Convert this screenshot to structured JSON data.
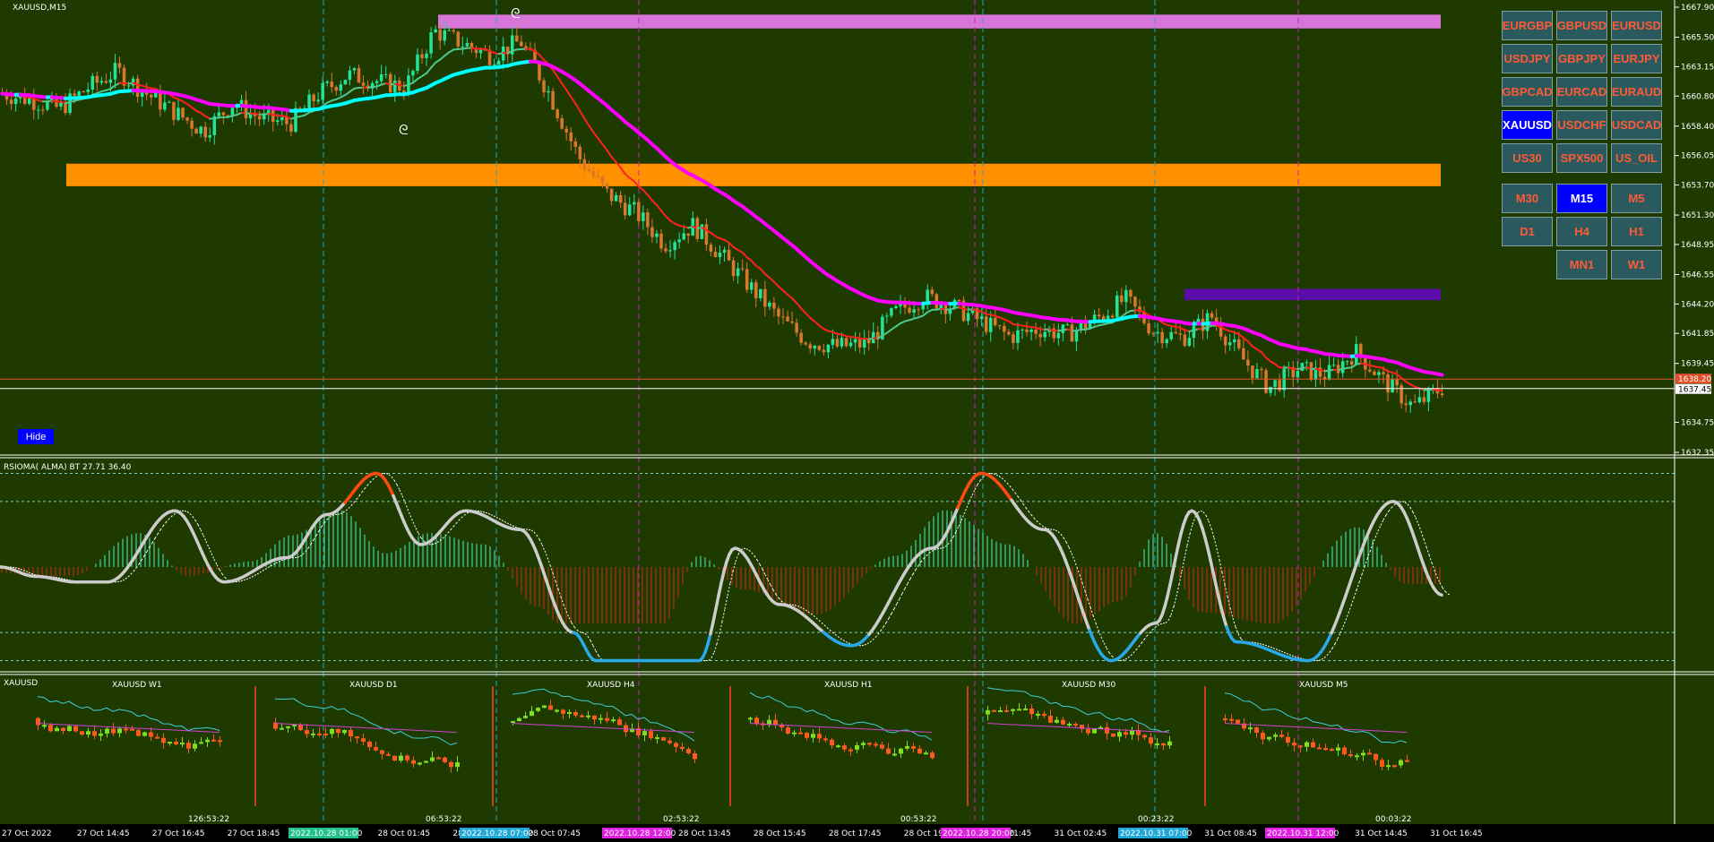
{
  "window": {
    "symbol_label": "XAUUSD,M15"
  },
  "colors": {
    "background": "#1e3a00",
    "bull": "#22e39a",
    "bear": "#d9772c",
    "ma_fast": "#ff2020",
    "ma_slow": "#ff00ff",
    "ma_fast_bull": "#4dc990",
    "ma_slow_bull": "#00ffff",
    "zone_top": "#d875d8",
    "zone_mid": "#ff9000",
    "zone_right": "#5a0ca8",
    "vline_cyan": "#20a8c0",
    "vline_magenta": "#c020c0",
    "rsi_line": "#cccccc",
    "rsi_hot": "#ff4a10",
    "rsi_cold": "#2aa8e8",
    "mini_bull": "#7ee01e",
    "mini_bear": "#ff5a1c",
    "active_button": "#0000ff"
  },
  "price_axis": {
    "ticks": [
      "1667.90",
      "1665.50",
      "1663.15",
      "1660.80",
      "1658.40",
      "1656.05",
      "1653.70",
      "1651.30",
      "1648.95",
      "1646.55",
      "1644.20",
      "1641.85",
      "1639.45",
      "1634.75",
      "1632.35"
    ],
    "price_tag_red": "1638.20",
    "price_tag_white": "1637.45"
  },
  "chart_data": {
    "type": "candlestick",
    "symbol": "XAUUSD",
    "timeframe": "M15",
    "y_range": [
      1632.35,
      1667.9
    ],
    "current_price": 1637.45,
    "close_path": [
      1661.0,
      1660.5,
      1659.8,
      1661.5,
      1662.8,
      1661.0,
      1659.5,
      1658.0,
      1660.2,
      1659.0,
      1658.6,
      1661.0,
      1662.5,
      1662.0,
      1661.5,
      1666.0,
      1665.0,
      1664.0,
      1665.2,
      1661.0,
      1656.0,
      1653.0,
      1651.5,
      1649.0,
      1650.5,
      1648.0,
      1645.5,
      1643.0,
      1641.2,
      1640.8,
      1641.0,
      1643.5,
      1644.8,
      1644.0,
      1642.8,
      1641.6,
      1642.2,
      1641.8,
      1643.0,
      1644.6,
      1642.0,
      1641.5,
      1643.2,
      1640.0,
      1637.5,
      1639.0,
      1638.5,
      1640.4,
      1638.0,
      1636.0,
      1637.5
    ],
    "horizontal_zones": [
      {
        "name": "top",
        "price_top": 1667.3,
        "price_bottom": 1666.2
      },
      {
        "name": "middle",
        "price_top": 1655.4,
        "price_bottom": 1653.6
      },
      {
        "name": "right",
        "price_top": 1645.4,
        "price_bottom": 1644.5
      }
    ],
    "rsi_pane": {
      "title": "RSIOMA( ALMA) BT 27.71 36.40",
      "levels": [
        "100",
        "85",
        "15",
        "0"
      ],
      "axis_extra": [
        "105",
        "-5"
      ]
    },
    "mini_pane": {
      "axis": [
        "115",
        "0.00",
        "-15"
      ],
      "panels": [
        {
          "title": "XAUUSD  W1",
          "timer": "126:53:22"
        },
        {
          "title": "XAUUSD  D1",
          "timer": "06:53:22"
        },
        {
          "title": "XAUUSD  H4",
          "timer": "02:53:22"
        },
        {
          "title": "XAUUSD  H1",
          "timer": "00:53:22"
        },
        {
          "title": "XAUUSD  M30",
          "timer": "00:23:22"
        },
        {
          "title": "XAUUSD  M5",
          "timer": "00:03:22"
        }
      ]
    },
    "time_axis": [
      "27 Oct 2022",
      "27 Oct 14:45",
      "27 Oct 16:45",
      "27 Oct 18:45",
      "27 Oct 20:45",
      "28 Oct 01:45",
      "28 Oct 03:45",
      "28 Oct 07:45",
      "28 Oct 09:45",
      "28 Oct 13:45",
      "28 Oct 15:45",
      "28 Oct 17:45",
      "28 Oct 19:45",
      "28 Oct 21:45",
      "31 Oct 02:45",
      "31 Oct 04:45",
      "31 Oct 08:45",
      "31 Oct 12:45",
      "31 Oct 14:45",
      "31 Oct 16:45"
    ],
    "time_tags": [
      {
        "text": "2022.10.28 01:00",
        "color": "#22c08a"
      },
      {
        "text": "2022.10.28 07:00",
        "color": "#20a8d8"
      },
      {
        "text": "2022.10.28 12:00",
        "color": "#e020e0"
      },
      {
        "text": "2022.10.28 20:00",
        "color": "#e020e0"
      },
      {
        "text": "2022.10.31 07:00",
        "color": "#20a8d8"
      },
      {
        "text": "2022.10.31 12:00",
        "color": "#e020e0"
      }
    ]
  },
  "mini_label": "XAUUSD",
  "symbols": [
    "EURGBP",
    "GBPUSD",
    "EURUSD",
    "USDJPY",
    "GBPJPY",
    "EURJPY",
    "GBPCAD",
    "EURCAD",
    "EURAUD",
    "XAUUSD",
    "USDCHF",
    "USDCAD",
    "US30",
    "SPX500",
    "US_OIL"
  ],
  "active_symbol": "XAUUSD",
  "timeframes": [
    "M30",
    "M15",
    "M5",
    "D1",
    "H4",
    "H1",
    "MN1",
    "W1"
  ],
  "active_timeframe": "M15",
  "hide_button": "Hide"
}
